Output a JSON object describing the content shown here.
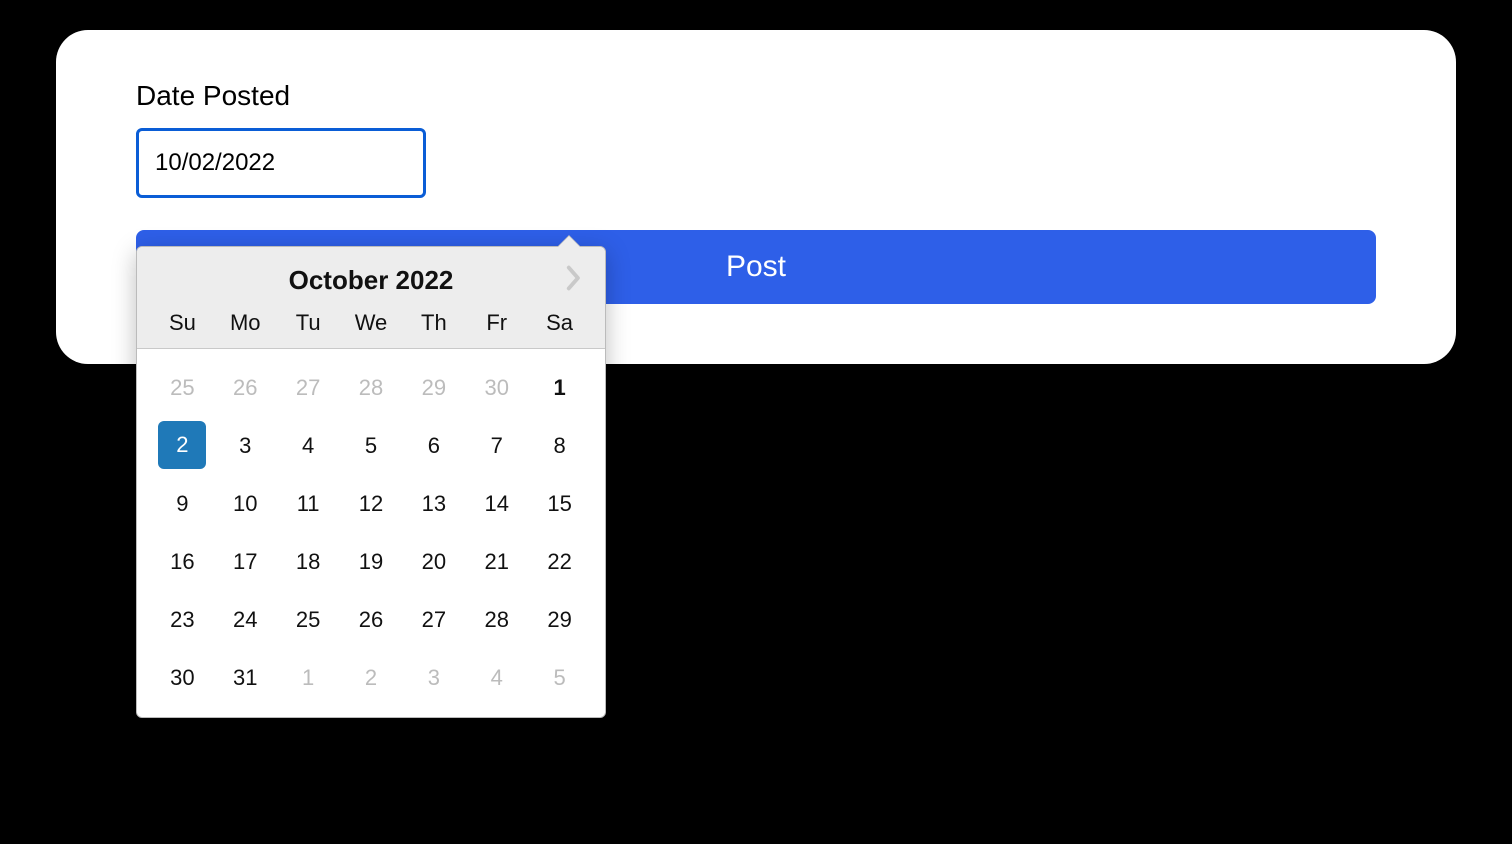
{
  "form": {
    "label": "Date Posted",
    "date_value": "10/02/2022",
    "submit_label": "Post"
  },
  "calendar": {
    "title": "October 2022",
    "dow": [
      "Su",
      "Mo",
      "Tu",
      "We",
      "Th",
      "Fr",
      "Sa"
    ],
    "days": [
      {
        "n": "25",
        "muted": true
      },
      {
        "n": "26",
        "muted": true
      },
      {
        "n": "27",
        "muted": true
      },
      {
        "n": "28",
        "muted": true
      },
      {
        "n": "29",
        "muted": true
      },
      {
        "n": "30",
        "muted": true
      },
      {
        "n": "1",
        "bold": true
      },
      {
        "n": "2",
        "selected": true
      },
      {
        "n": "3"
      },
      {
        "n": "4"
      },
      {
        "n": "5"
      },
      {
        "n": "6"
      },
      {
        "n": "7"
      },
      {
        "n": "8"
      },
      {
        "n": "9"
      },
      {
        "n": "10"
      },
      {
        "n": "11"
      },
      {
        "n": "12"
      },
      {
        "n": "13"
      },
      {
        "n": "14"
      },
      {
        "n": "15"
      },
      {
        "n": "16"
      },
      {
        "n": "17"
      },
      {
        "n": "18"
      },
      {
        "n": "19"
      },
      {
        "n": "20"
      },
      {
        "n": "21"
      },
      {
        "n": "22"
      },
      {
        "n": "23"
      },
      {
        "n": "24"
      },
      {
        "n": "25"
      },
      {
        "n": "26"
      },
      {
        "n": "27"
      },
      {
        "n": "28"
      },
      {
        "n": "29"
      },
      {
        "n": "30"
      },
      {
        "n": "31"
      },
      {
        "n": "1",
        "muted": true
      },
      {
        "n": "2",
        "muted": true
      },
      {
        "n": "3",
        "muted": true
      },
      {
        "n": "4",
        "muted": true
      },
      {
        "n": "5",
        "muted": true
      }
    ]
  }
}
